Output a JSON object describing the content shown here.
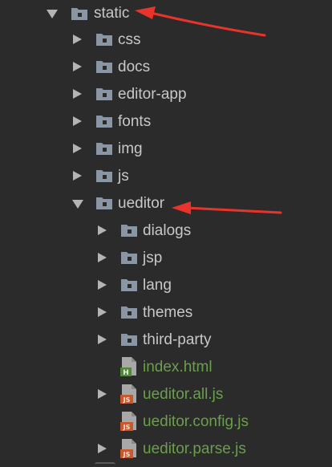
{
  "project_tree": {
    "items": [
      {
        "label": "static",
        "kind": "folder",
        "state": "expanded",
        "icon": "folder-icon"
      },
      {
        "label": "css",
        "kind": "folder",
        "state": "collapsed",
        "icon": "folder-icon"
      },
      {
        "label": "docs",
        "kind": "folder",
        "state": "collapsed",
        "icon": "folder-icon"
      },
      {
        "label": "editor-app",
        "kind": "folder",
        "state": "collapsed",
        "icon": "folder-icon"
      },
      {
        "label": "fonts",
        "kind": "folder",
        "state": "collapsed",
        "icon": "folder-icon"
      },
      {
        "label": "img",
        "kind": "folder",
        "state": "collapsed",
        "icon": "folder-icon"
      },
      {
        "label": "js",
        "kind": "folder",
        "state": "collapsed",
        "icon": "folder-icon"
      },
      {
        "label": "ueditor",
        "kind": "folder",
        "state": "expanded",
        "icon": "folder-icon"
      },
      {
        "label": "dialogs",
        "kind": "folder",
        "state": "collapsed",
        "icon": "folder-icon"
      },
      {
        "label": "jsp",
        "kind": "folder",
        "state": "collapsed",
        "icon": "folder-icon"
      },
      {
        "label": "lang",
        "kind": "folder",
        "state": "collapsed",
        "icon": "folder-icon"
      },
      {
        "label": "themes",
        "kind": "folder",
        "state": "collapsed",
        "icon": "folder-icon"
      },
      {
        "label": "third-party",
        "kind": "folder",
        "state": "collapsed",
        "icon": "folder-icon"
      },
      {
        "label": "index.html",
        "kind": "file",
        "state": "none",
        "icon": "html-file-icon",
        "badge": "H"
      },
      {
        "label": "ueditor.all.js",
        "kind": "file",
        "state": "collapsed",
        "icon": "js-file-icon",
        "badge": "JS"
      },
      {
        "label": "ueditor.config.js",
        "kind": "file",
        "state": "none",
        "icon": "js-file-icon",
        "badge": "JS"
      },
      {
        "label": "ueditor.parse.js",
        "kind": "file",
        "state": "collapsed",
        "icon": "js-file-icon",
        "badge": "JS"
      }
    ]
  },
  "colors": {
    "background": "#2b2b2b",
    "folder_label": "#c8c8c8",
    "file_label": "#6a9f4b",
    "arrow": "#b4b4b4",
    "folder_icon": "#8a96a3",
    "html_badge": "#4f8a3a",
    "js_badge": "#c65a2e",
    "annotation_arrow": "#e8342a"
  },
  "annotations": [
    {
      "name": "red-arrow-to-static"
    },
    {
      "name": "red-arrow-to-ueditor"
    }
  ]
}
